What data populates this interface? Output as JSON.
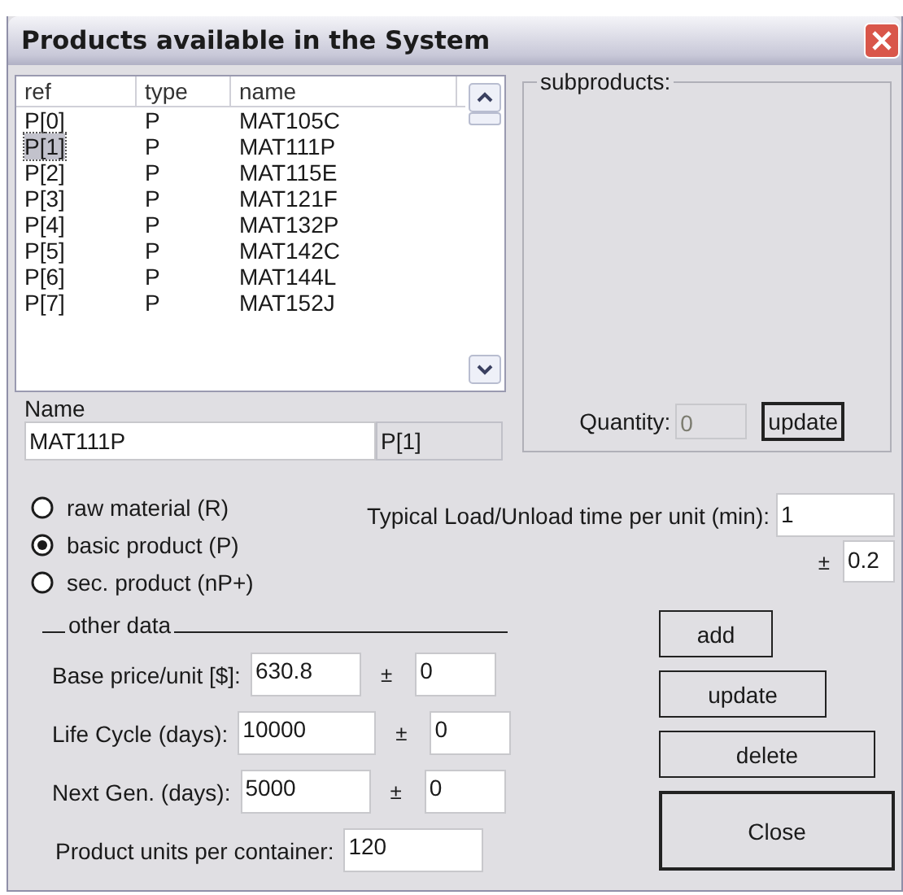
{
  "window": {
    "title": "Products available in the System"
  },
  "product_list": {
    "columns": [
      "ref",
      "type",
      "name"
    ],
    "rows": [
      {
        "ref": "P[0]",
        "type": "P",
        "name": "MAT105C",
        "selected": false
      },
      {
        "ref": "P[1]",
        "type": "P",
        "name": "MAT111P",
        "selected": true
      },
      {
        "ref": "P[2]",
        "type": "P",
        "name": "MAT115E",
        "selected": false
      },
      {
        "ref": "P[3]",
        "type": "P",
        "name": "MAT121F",
        "selected": false
      },
      {
        "ref": "P[4]",
        "type": "P",
        "name": "MAT132P",
        "selected": false
      },
      {
        "ref": "P[5]",
        "type": "P",
        "name": "MAT142C",
        "selected": false
      },
      {
        "ref": "P[6]",
        "type": "P",
        "name": "MAT144L",
        "selected": false
      },
      {
        "ref": "P[7]",
        "type": "P",
        "name": "MAT152J",
        "selected": false
      }
    ]
  },
  "name_label": "Name",
  "name_value": "MAT111P",
  "ref_value": "P[1]",
  "subproducts": {
    "title": "subproducts:",
    "quantity_label": "Quantity:",
    "quantity_value": "0",
    "quantity_disabled": true,
    "update_button": "update"
  },
  "product_types": [
    {
      "label": "raw material (R)",
      "selected": false
    },
    {
      "label": "basic product (P)",
      "selected": true
    },
    {
      "label": "sec. product (nP+)",
      "selected": false
    }
  ],
  "load_time": {
    "label": "Typical Load/Unload time per unit (min):",
    "value": "1",
    "pm": "±",
    "deviation": "0.2"
  },
  "other_data": {
    "title": "other data",
    "fields": [
      {
        "label": "Base price/unit [$]:",
        "value": "630.8",
        "pm": "±",
        "deviation": "0"
      },
      {
        "label": "Life Cycle (days):",
        "value": "10000",
        "pm": "±",
        "deviation": "0"
      },
      {
        "label": "Next Gen. (days):",
        "value": "5000",
        "pm": "±",
        "deviation": "0"
      }
    ],
    "units_label": "Product units per container:",
    "units_value": "120"
  },
  "buttons": [
    "add",
    "update",
    "delete",
    "Close"
  ]
}
